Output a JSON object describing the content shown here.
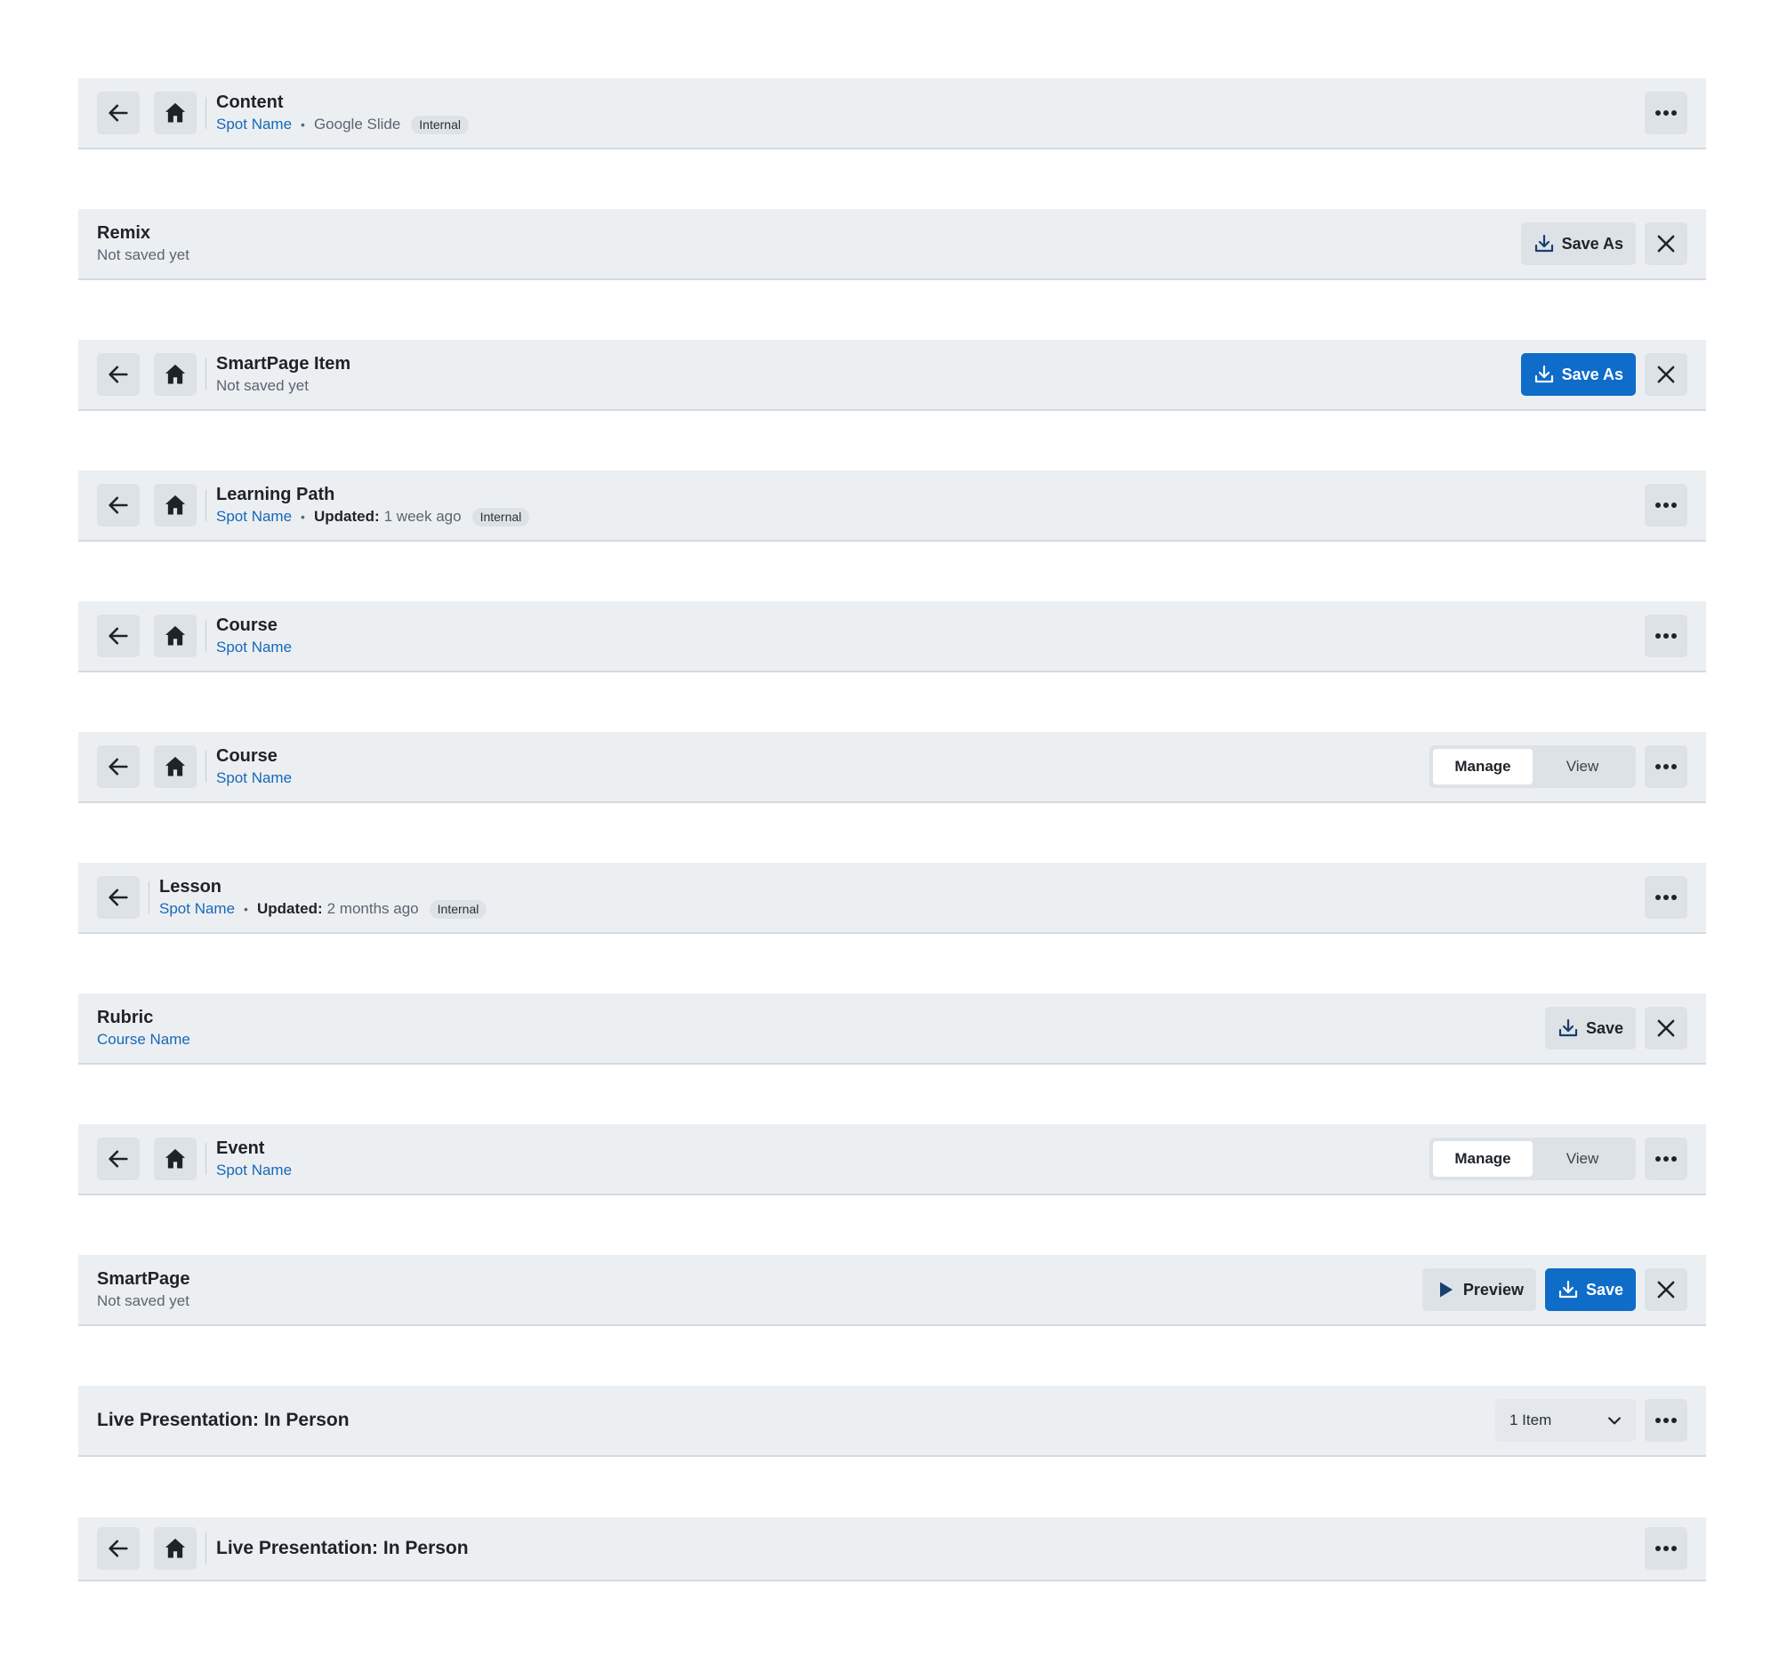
{
  "headers": [
    {
      "variant": "nav",
      "title": "Content",
      "subtitle": {
        "link": "Spot Name",
        "type_text": "Google Slide",
        "tag": "Internal"
      },
      "actions": [
        "more"
      ],
      "icons": [
        "arrow-left-icon",
        "home-icon",
        "more-horizontal-icon"
      ]
    },
    {
      "variant": "plain",
      "title": "Remix",
      "subtitle": {
        "status": "Not saved yet"
      },
      "actions": [
        {
          "type": "secondary",
          "label": "Save As",
          "icon": "download-icon"
        },
        "close"
      ]
    },
    {
      "variant": "nav",
      "title": "SmartPage Item",
      "subtitle": {
        "status": "Not saved yet"
      },
      "actions": [
        {
          "type": "primary",
          "label": "Save As",
          "icon": "download-icon"
        },
        "close"
      ]
    },
    {
      "variant": "nav",
      "title": "Learning Path",
      "subtitle": {
        "link": "Spot Name",
        "updated_label": "Updated:",
        "updated_value": "1 week ago",
        "tag": "Internal"
      },
      "actions": [
        "more"
      ]
    },
    {
      "variant": "nav",
      "title": "Course",
      "subtitle": {
        "link": "Spot Name"
      },
      "actions": [
        "more"
      ]
    },
    {
      "variant": "nav",
      "title": "Course",
      "subtitle": {
        "link": "Spot Name"
      },
      "segmented": {
        "options": [
          "Manage",
          "View"
        ],
        "selected": "Manage"
      },
      "actions": [
        "more"
      ]
    },
    {
      "variant": "back-only",
      "title": "Lesson",
      "subtitle": {
        "link": "Spot Name",
        "updated_label": "Updated:",
        "updated_value": "2 months ago",
        "tag": "Internal"
      },
      "actions": [
        "more"
      ]
    },
    {
      "variant": "plain",
      "title": "Rubric",
      "subtitle": {
        "link": "Course Name"
      },
      "actions": [
        {
          "type": "secondary",
          "label": "Save",
          "icon": "download-icon"
        },
        "close"
      ]
    },
    {
      "variant": "nav",
      "title": "Event",
      "subtitle": {
        "link": "Spot Name"
      },
      "segmented": {
        "options": [
          "Manage",
          "View"
        ],
        "selected": "Manage"
      },
      "actions": [
        "more"
      ]
    },
    {
      "variant": "plain",
      "title": "SmartPage",
      "subtitle": {
        "status": "Not saved yet"
      },
      "actions": [
        {
          "type": "secondary",
          "label": "Preview",
          "icon": "play-icon"
        },
        {
          "type": "primary",
          "label": "Save",
          "icon": "download-icon"
        },
        "close"
      ]
    },
    {
      "variant": "plain",
      "title": "Live Presentation: In Person",
      "dropdown": {
        "value": "1 Item",
        "icon": "chevron-down-icon"
      },
      "actions": [
        "more"
      ]
    },
    {
      "variant": "nav",
      "title": "Live Presentation: In Person",
      "actions": [
        "more"
      ]
    }
  ],
  "colors": {
    "bar_background": "#eceff2",
    "button_background": "#dde2e7",
    "primary": "#0f6cc8",
    "link": "#1668b8",
    "icon": "#1f2328"
  }
}
